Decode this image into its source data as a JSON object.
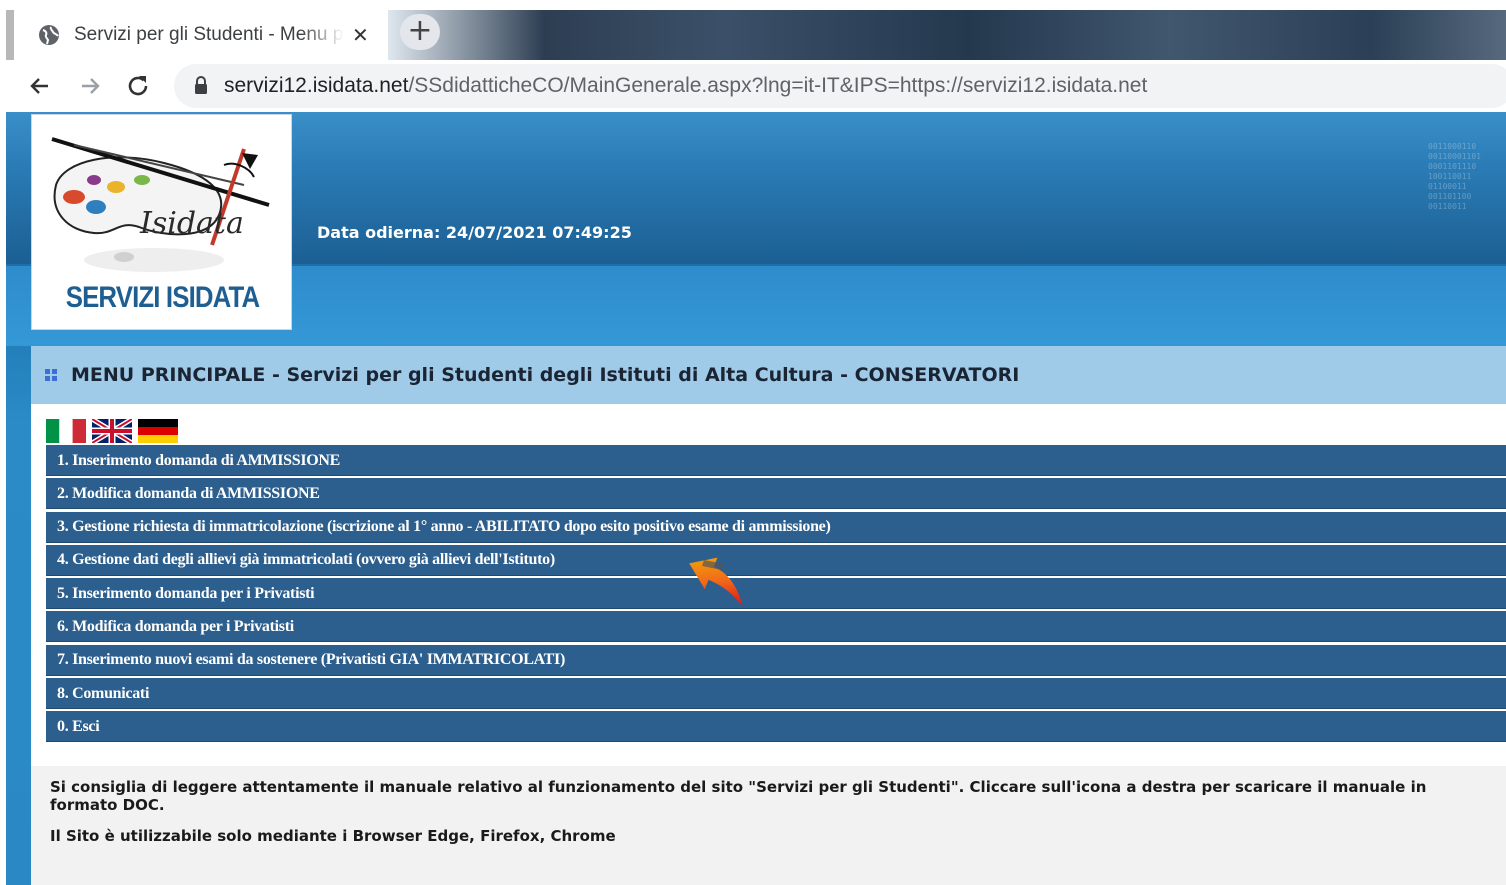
{
  "browser": {
    "tab_title": "Servizi per gli Studenti - Menu principale",
    "close_glyph": "✕",
    "new_tab_glyph": "+",
    "url_host": "servizi12.isidata.net",
    "url_path": "/SSdidatticheCO/MainGenerale.aspx?lng=it-IT&IPS=https://servizi12.isidata.net",
    "icons": [
      "globe-icon",
      "back-arrow-icon",
      "forward-arrow-icon",
      "reload-icon",
      "lock-icon"
    ]
  },
  "header": {
    "logo_wordmark": "Isidata",
    "logo_caption": "SERVIZI ISIDATA",
    "date_label": "Data odierna: 24/07/2021 07:49:25"
  },
  "main": {
    "title": "MENU PRINCIPALE - Servizi per gli Studenti degli Istituti di Alta Cultura - CONSERVATORI",
    "languages": [
      "Italiano",
      "English",
      "Deutsch"
    ],
    "menu_items": [
      "1. Inserimento domanda di AMMISSIONE",
      "2. Modifica domanda di AMMISSIONE",
      "3. Gestione richiesta di immatricolazione (iscrizione al 1° anno - ABILITATO dopo esito positivo esame di ammissione)",
      "4. Gestione dati degli allievi già immatricolati (ovvero già allievi dell'Istituto)",
      "5. Inserimento domanda per i Privatisti",
      "6. Modifica domanda per i Privatisti",
      "7. Inserimento nuovi esami da sostenere (Privatisti GIA' IMMATRICOLATI)",
      "8. Comunicati",
      "0. Esci"
    ],
    "notice_manual": "Si consiglia di leggere attentamente il manuale relativo al funzionamento del sito \"Servizi per gli Studenti\". Cliccare sull'icona a destra per scaricare il manuale in formato DOC.",
    "notice_browsers": "Il Sito è utilizzabile solo mediante i Browser Edge, Firefox, Chrome"
  },
  "colors": {
    "header_blue": "#1c73ab",
    "title_bar": "#9fcbe8",
    "menu_item": "#2c5f8d",
    "logo_text": "#1e5e91"
  }
}
